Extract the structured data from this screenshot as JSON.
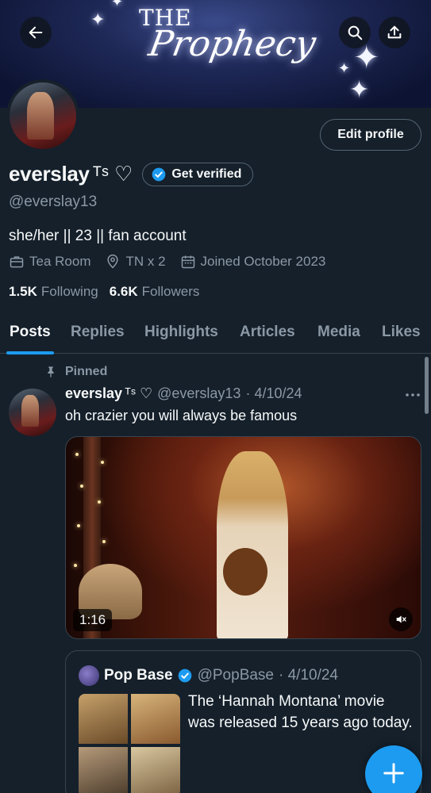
{
  "banner": {
    "title_top": "THE",
    "title_script": "Prophecy"
  },
  "header": {
    "back_icon": "arrow-left-icon",
    "search_icon": "search-icon",
    "share_icon": "share-icon"
  },
  "profile": {
    "edit_label": "Edit profile",
    "display_name": "everslay",
    "name_suffix": "ᵀˢ ♡",
    "verified_label": "Get verified",
    "handle": "@everslay13",
    "bio": "she/her || 23 || fan account",
    "meta": {
      "category": "Tea Room",
      "location": "TN x 2",
      "joined": "Joined October 2023"
    },
    "following_count": "1.5K",
    "following_label": "Following",
    "followers_count": "6.6K",
    "followers_label": "Followers"
  },
  "tabs": [
    "Posts",
    "Replies",
    "Highlights",
    "Articles",
    "Media",
    "Likes"
  ],
  "active_tab": "Posts",
  "post": {
    "pinned_label": "Pinned",
    "author_name": "everslay",
    "author_suffix": "ᵀˢ ♡",
    "author_handle": "@everslay13",
    "date": "· 4/10/24",
    "text": "oh crazier you will always be famous",
    "video_duration": "1:16",
    "quote": {
      "name": "Pop Base",
      "handle": "@PopBase",
      "date": "· 4/10/24",
      "text": "The ‘Hannah Montana’ movie was released 15 years ago today."
    }
  },
  "colors": {
    "background": "#15202b",
    "accent": "#1d9bf0",
    "secondary_text": "#8b98a5",
    "border": "#38444d"
  }
}
